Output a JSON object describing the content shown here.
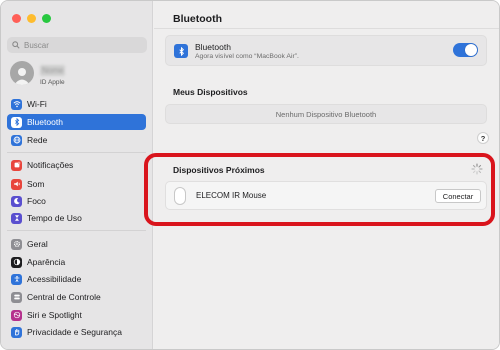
{
  "window": {
    "controls": [
      {
        "name": "close",
        "color": "#ff5f57"
      },
      {
        "name": "minimize",
        "color": "#febc2e"
      },
      {
        "name": "zoom",
        "color": "#28c840"
      }
    ]
  },
  "sidebar": {
    "search_placeholder": "Buscar",
    "account": {
      "name": "Nome",
      "subtitle": "ID Apple"
    },
    "groups": [
      [
        {
          "label": "Wi-Fi",
          "icon": "wifi-icon",
          "color": "#2f73d9"
        },
        {
          "label": "Bluetooth",
          "icon": "bluetooth-icon",
          "color": "#2f73d9",
          "selected": true
        },
        {
          "label": "Rede",
          "icon": "globe-icon",
          "color": "#2f73d9"
        }
      ],
      [
        {
          "label": "Notificações",
          "icon": "notifications-icon",
          "color": "#e8453c"
        },
        {
          "label": "Som",
          "icon": "speaker-icon",
          "color": "#e8453c"
        },
        {
          "label": "Foco",
          "icon": "moon-icon",
          "color": "#5a4fcf"
        },
        {
          "label": "Tempo de Uso",
          "icon": "hourglass-icon",
          "color": "#5a4fcf"
        }
      ],
      [
        {
          "label": "Geral",
          "icon": "gear-icon",
          "color": "#8e8e93"
        },
        {
          "label": "Aparência",
          "icon": "appearance-icon",
          "color": "#1d1d1f"
        },
        {
          "label": "Acessibilidade",
          "icon": "accessibility-icon",
          "color": "#2f73d9"
        },
        {
          "label": "Central de Controle",
          "icon": "control-center-icon",
          "color": "#8e8e93"
        },
        {
          "label": "Siri e Spotlight",
          "icon": "siri-icon",
          "color": "#b5308d"
        },
        {
          "label": "Privacidade e Segurança",
          "icon": "hand-icon",
          "color": "#2f73d9"
        }
      ]
    ]
  },
  "main": {
    "title": "Bluetooth",
    "bluetooth_card": {
      "label": "Bluetooth",
      "subtitle": "Agora visível como “MacBook Air”.",
      "enabled": true
    },
    "my_devices": {
      "title": "Meus Dispositivos",
      "empty_text": "Nenhum Dispositivo Bluetooth"
    },
    "help_label": "?",
    "nearby": {
      "title": "Dispositivos Próximos",
      "devices": [
        {
          "name": "ELECOM IR Mouse",
          "action": "Conectar"
        }
      ]
    }
  },
  "colors": {
    "accent": "#2f73d9",
    "highlight": "#d9141c"
  }
}
